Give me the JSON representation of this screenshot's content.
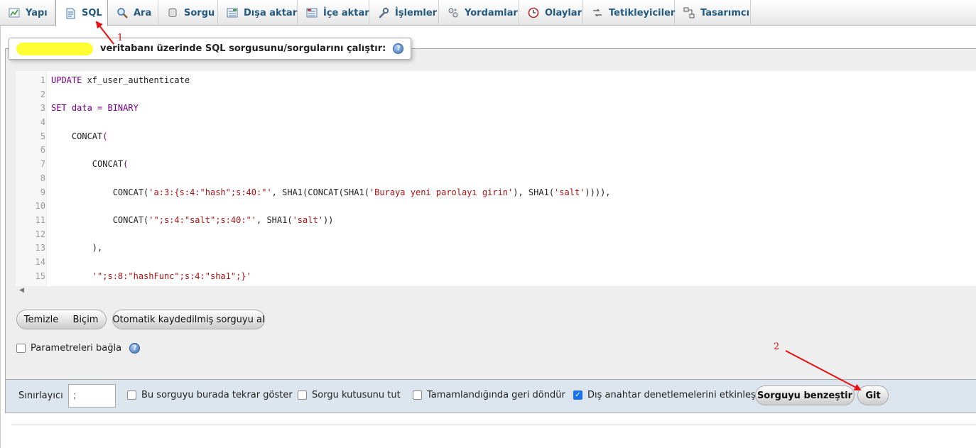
{
  "tabs": [
    {
      "label": "Yapı",
      "icon": "structure-icon"
    },
    {
      "label": "SQL",
      "icon": "sql-icon",
      "active": true
    },
    {
      "label": "Ara",
      "icon": "search-icon"
    },
    {
      "label": "Sorgu",
      "icon": "query-icon"
    },
    {
      "label": "Dışa aktar",
      "icon": "export-icon"
    },
    {
      "label": "İçe aktar",
      "icon": "import-icon"
    },
    {
      "label": "İşlemler",
      "icon": "wrench-icon"
    },
    {
      "label": "Yordamlar",
      "icon": "routines-icon"
    },
    {
      "label": "Olaylar",
      "icon": "clock-icon"
    },
    {
      "label": "Tetikleyiciler",
      "icon": "triggers-icon"
    },
    {
      "label": "Tasarımcı",
      "icon": "designer-icon"
    }
  ],
  "query": {
    "legend_text": "veritabanı üzerinde SQL sorgusunu/sorgularını çalıştır:",
    "code_lines": [
      {
        "n": "1",
        "tokens": [
          {
            "t": "UPDATE",
            "c": "kw"
          },
          {
            "t": " xf_user_authenticate",
            "c": "fn"
          }
        ]
      },
      {
        "n": "2",
        "tokens": []
      },
      {
        "n": "3",
        "tokens": [
          {
            "t": "SET data = BINARY",
            "c": "kw"
          }
        ]
      },
      {
        "n": "4",
        "tokens": []
      },
      {
        "n": "5",
        "tokens": [
          {
            "t": "    CONCAT",
            "c": "fn"
          },
          {
            "t": "(",
            "c": "kw"
          }
        ]
      },
      {
        "n": "6",
        "tokens": []
      },
      {
        "n": "7",
        "tokens": [
          {
            "t": "        CONCAT",
            "c": "fn"
          },
          {
            "t": "(",
            "c": "kw"
          }
        ]
      },
      {
        "n": "8",
        "tokens": []
      },
      {
        "n": "9",
        "tokens": [
          {
            "t": "            CONCAT(",
            "c": "fn"
          },
          {
            "t": "'a:3:{s:4:\"hash\";s:40:\"'",
            "c": "st"
          },
          {
            "t": ", SHA1(CONCAT(SHA1(",
            "c": "fn"
          },
          {
            "t": "'Buraya yeni parolayı girin'",
            "c": "st"
          },
          {
            "t": "), SHA1(",
            "c": "fn"
          },
          {
            "t": "'salt'",
            "c": "st"
          },
          {
            "t": ")))),",
            "c": "fn"
          }
        ]
      },
      {
        "n": "10",
        "tokens": []
      },
      {
        "n": "11",
        "tokens": [
          {
            "t": "            CONCAT(",
            "c": "fn"
          },
          {
            "t": "'\";s:4:\"salt\";s:40:\"'",
            "c": "st"
          },
          {
            "t": ", SHA1(",
            "c": "fn"
          },
          {
            "t": "'salt'",
            "c": "st"
          },
          {
            "t": "))",
            "c": "fn"
          }
        ]
      },
      {
        "n": "12",
        "tokens": []
      },
      {
        "n": "13",
        "tokens": [
          {
            "t": "        ),",
            "c": "fn"
          }
        ]
      },
      {
        "n": "14",
        "tokens": []
      },
      {
        "n": "15",
        "tokens": [
          {
            "t": "        '\";s:8:\"hashFunc\";s:4:\"sha1\";}'",
            "c": "st"
          }
        ]
      }
    ]
  },
  "buttons": {
    "clear": "Temizle",
    "format": "Biçim",
    "autosaved": "Otomatik kaydedilmiş sorguyu al",
    "simulate": "Sorguyu benzeştir",
    "go": "Git"
  },
  "bind_params_label": "Parametreleri bağla",
  "options": {
    "delimiter_label": "Sınırlayıcı",
    "delimiter_value": ";",
    "show_again_label": "Bu sorguyu burada tekrar göster",
    "keep_box_label": "Sorgu kutusunu tut",
    "rollback_label": "Tamamlandığında geri döndür",
    "fk_checks_label": "Dış anahtar denetlemelerini etkinleştir",
    "fk_checks_checked": true
  },
  "annotations": {
    "one": "1",
    "two": "2",
    "color": "#e81111"
  }
}
